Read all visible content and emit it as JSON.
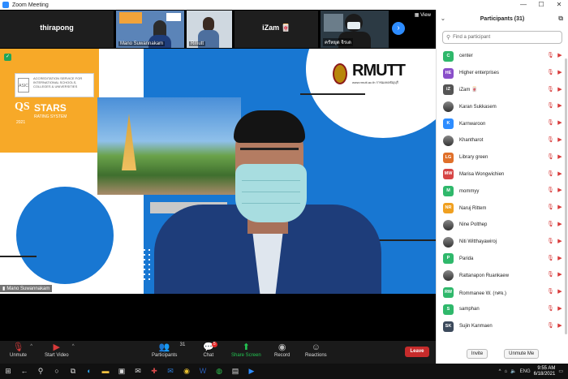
{
  "window": {
    "title": "Zoom Meeting",
    "minimize": "—",
    "maximize": "☐",
    "close": "✕"
  },
  "strip": {
    "view_label": "View",
    "next": "›",
    "thumbs": [
      {
        "name": "thirapong",
        "big": true
      },
      {
        "name": "Mano Suwannakam",
        "big": false
      },
      {
        "name": "Rmutt",
        "big": false
      },
      {
        "name": "iZam 🀄",
        "big": true
      },
      {
        "name": "ครัทยุต จิรเด",
        "big": false
      }
    ]
  },
  "stage": {
    "active_speaker": "Mano Suwannakam",
    "accreditation_text": "ACCREDITATION SERVICE FOR INTERNATIONAL SCHOOLS, COLLEGES & UNIVERSITIES",
    "accreditation_logo": "ASIC",
    "qs": {
      "logo": "QS",
      "stars": "STARS",
      "rating": "RATING SYSTEM",
      "year": "2021"
    },
    "rmutt": {
      "word": "RMUTT",
      "url": "www.rmutt.ac.th  ราชมงคลธัญบุรี"
    }
  },
  "toolbar": {
    "unmute": "Unmute",
    "start_video": "Start Video",
    "participants": "Participants",
    "participants_count": "31",
    "chat": "Chat",
    "chat_badge": "5",
    "share_screen": "Share Screen",
    "record": "Record",
    "reactions": "Reactions",
    "leave": "Leave"
  },
  "participants_panel": {
    "title": "Participants (31)",
    "search_placeholder": "Find a participant",
    "invite": "Invite",
    "unmute_me": "Unmute Me",
    "items": [
      {
        "initials": "C",
        "name": "center",
        "color": "#2fb86b"
      },
      {
        "initials": "HE",
        "name": "Higher enterprises",
        "color": "#8a4fc9"
      },
      {
        "initials": "iZ",
        "name": "iZam 🀄",
        "color": "#555555"
      },
      {
        "initials": "",
        "name": "Karan Sukkasem",
        "color": "#444444",
        "photo": true
      },
      {
        "initials": "K",
        "name": "Karnwaroon",
        "color": "#2d8cff"
      },
      {
        "initials": "",
        "name": "Khantharot",
        "color": "#444444",
        "photo": true
      },
      {
        "initials": "LG",
        "name": "Library green",
        "color": "#e0702a"
      },
      {
        "initials": "MW",
        "name": "Marisa Wongwichien",
        "color": "#d64545"
      },
      {
        "initials": "M",
        "name": "mommyy",
        "color": "#2fb86b"
      },
      {
        "initials": "NR",
        "name": "Naruj Rittem",
        "color": "#f0a020"
      },
      {
        "initials": "",
        "name": "Nine Polthep",
        "color": "#444444",
        "photo": true
      },
      {
        "initials": "",
        "name": "Niti Witthayawiroj",
        "color": "#444444",
        "photo": true
      },
      {
        "initials": "P",
        "name": "Parida",
        "color": "#2fb86b"
      },
      {
        "initials": "",
        "name": "Rattanapon Ruankaew",
        "color": "#444444",
        "photo": true
      },
      {
        "initials": "RW",
        "name": "Rommanee W. (กศจ.)",
        "color": "#2fb86b"
      },
      {
        "initials": "S",
        "name": "samphan",
        "color": "#2fb86b"
      },
      {
        "initials": "SK",
        "name": "Sujin Kanmaen",
        "color": "#3c4a5c"
      }
    ]
  },
  "taskbar": {
    "time": "9:55 AM",
    "date": "6/18/2021",
    "lang": "ENG"
  }
}
